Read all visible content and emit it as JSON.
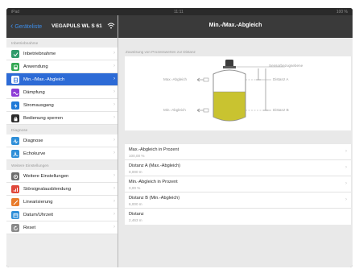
{
  "statusbar": {
    "left": "iPad",
    "time": "11:11",
    "right": "100 %"
  },
  "left_nav": {
    "back_label": "Geräteliste",
    "device_name": "VEGAPULS WL S 61"
  },
  "sidebar": {
    "sections": [
      {
        "header": "Inbetriebnahme",
        "items": [
          {
            "label": "Inbetriebnahme",
            "icon": "checklist-icon",
            "color": "#2f9b6b",
            "active": false
          },
          {
            "label": "Anwendung",
            "icon": "tank-icon",
            "color": "#33a853",
            "active": false
          },
          {
            "label": "Min.-/Max.-Abgleich",
            "icon": "level-icon",
            "color": "#2d6bd6",
            "active": true
          },
          {
            "label": "Dämpfung",
            "icon": "wave-icon",
            "color": "#8d3bd6",
            "active": false
          },
          {
            "label": "Stromausgang",
            "icon": "current-icon",
            "color": "#1f7ad8",
            "active": false
          },
          {
            "label": "Bedienung sperren",
            "icon": "lock-icon",
            "color": "#2b2b2b",
            "active": false
          }
        ]
      },
      {
        "header": "Diagnose",
        "items": [
          {
            "label": "Diagnose",
            "icon": "diagnosis-icon",
            "color": "#2f8fd8",
            "active": false
          },
          {
            "label": "Echokurve",
            "icon": "echo-curve-icon",
            "color": "#2f8fd8",
            "active": false
          }
        ]
      },
      {
        "header": "Weitere Einstellungen",
        "items": [
          {
            "label": "Weitere Einstellungen",
            "icon": "settings-icon",
            "color": "#6e6e6e",
            "active": false
          },
          {
            "label": "Störsignalausblendung",
            "icon": "signal-icon",
            "color": "#e0483b",
            "active": false
          },
          {
            "label": "Linearisierung",
            "icon": "linear-icon",
            "color": "#e87b2b",
            "active": false
          },
          {
            "label": "Datum/Uhrzeit",
            "icon": "calendar-icon",
            "color": "#2f8fd8",
            "active": false
          },
          {
            "label": "Reset",
            "icon": "reset-icon",
            "color": "#8a8a8a",
            "active": false
          }
        ]
      }
    ]
  },
  "main": {
    "title": "Min.-/Max.-Abgleich",
    "diagram": {
      "caption": "Zuweisung von Prozesswerten zur Distanz",
      "label_max": "Max.-Abgleich",
      "label_min": "Min.-Abgleich",
      "label_ref": "Sensorbezugsebene",
      "label_dist_a": "Distanz A",
      "label_dist_b": "Distanz B",
      "fill_color": "#c9c330"
    },
    "rows": [
      {
        "title": "Max.-Abgleich in Prozent",
        "value": "100,00 %"
      },
      {
        "title": "Distanz A (Max.-Abgleich)",
        "value": "0,000 m"
      },
      {
        "title": "Min.-Abgleich in Prozent",
        "value": "0,00 %"
      },
      {
        "title": "Distanz B (Min.-Abgleich)",
        "value": "6,000 m"
      },
      {
        "title": "Distanz",
        "value": "2,463 m"
      }
    ]
  }
}
